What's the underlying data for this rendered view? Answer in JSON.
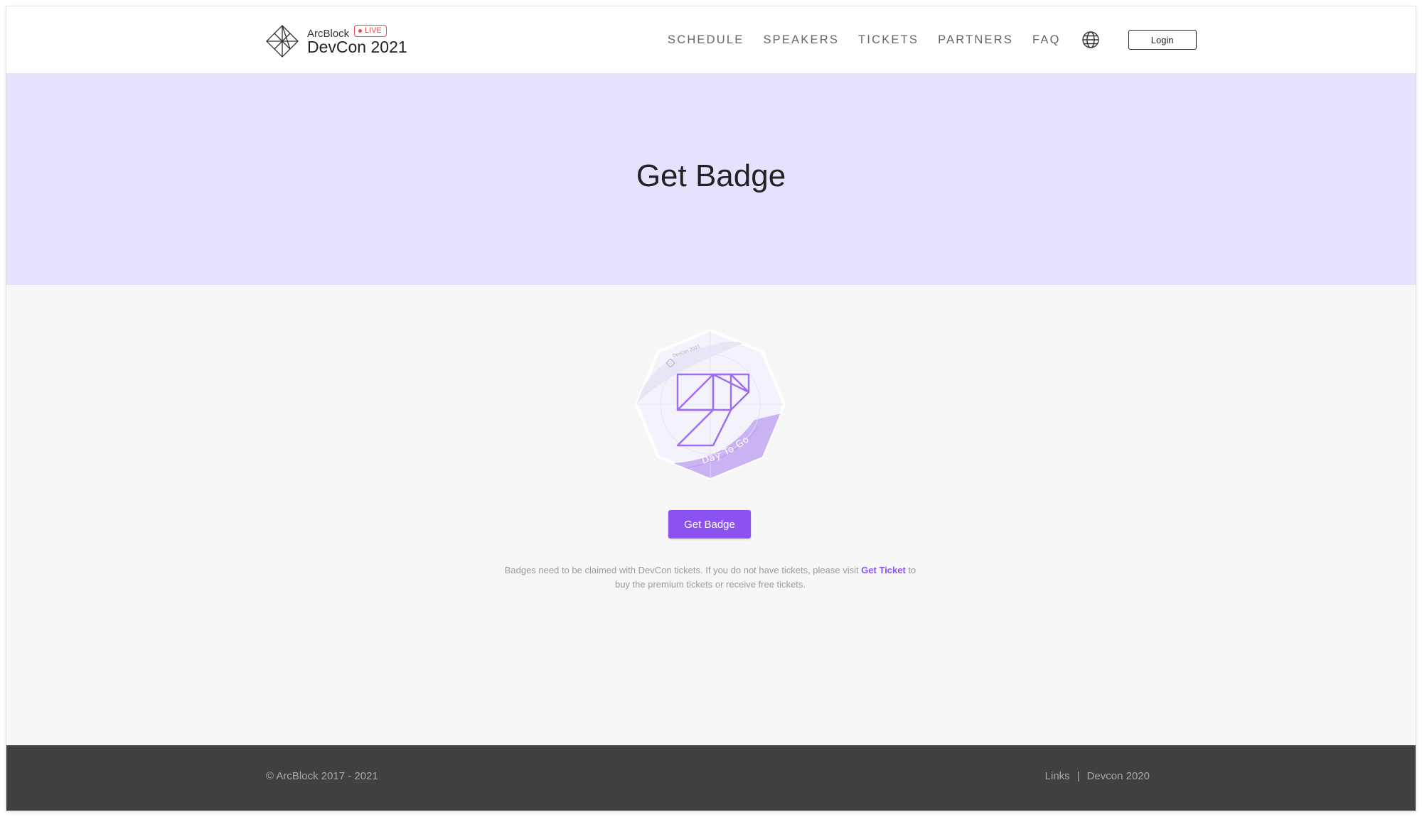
{
  "header": {
    "logo": {
      "brand": "ArcBlock",
      "live_label": "LIVE",
      "title": "DevCon 2021",
      "icon": "arcblock-diamond-icon"
    },
    "nav": [
      {
        "label": "SCHEDULE"
      },
      {
        "label": "SPEAKERS"
      },
      {
        "label": "TICKETS"
      },
      {
        "label": "PARTNERS"
      },
      {
        "label": "FAQ"
      }
    ],
    "language_icon": "globe-icon",
    "login_label": "Login"
  },
  "hero": {
    "title": "Get Badge"
  },
  "badge": {
    "header_text": "DevCon 2021",
    "ribbon_text": "Day To Go",
    "accent_color": "#8a52f0"
  },
  "main": {
    "button_label": "Get Badge",
    "note_before": "Badges need to be claimed with DevCon tickets. If you do not have tickets, please visit ",
    "note_link": "Get Ticket",
    "note_after": " to buy the premium tickets or receive free tickets."
  },
  "footer": {
    "copyright": "© ArcBlock 2017 - 2021",
    "links": [
      {
        "label": "Links"
      },
      {
        "label": "Devcon 2020"
      }
    ],
    "separator": "|"
  },
  "colors": {
    "hero_bg": "#e6e2fd",
    "primary": "#8a52f0",
    "footer_bg": "#404040",
    "live": "#e94b4b"
  }
}
